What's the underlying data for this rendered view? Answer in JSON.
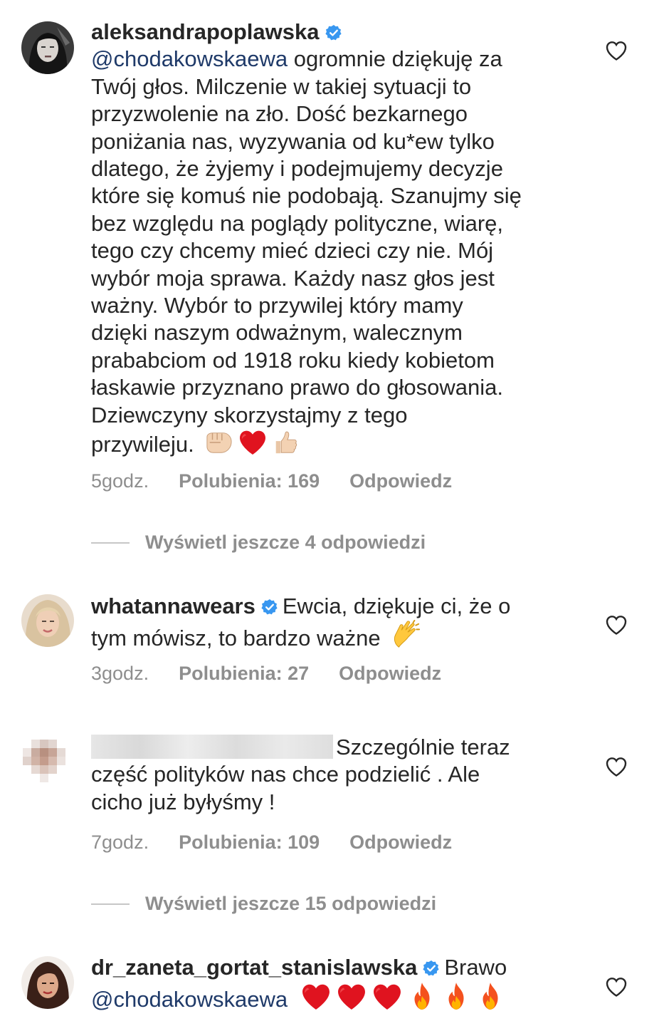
{
  "comments": [
    {
      "username": "aleksandrapoplawska",
      "verified": true,
      "mention": "@chodakowskaewa",
      "text_lines": [
        " ogromnie dziękuję za",
        "Twój głos. Milczenie w takiej sytuacji  to",
        "przyzwolenie na zło. Dość bezkarnego",
        "poniżania nas, wyzywania od ku*ew tylko",
        "dlatego, że żyjemy i podejmujemy decyzje",
        "które się komuś nie podobają. Szanujmy się",
        "bez względu na poglądy polityczne, wiarę,",
        "tego czy chcemy mieć dzieci czy nie. Mój",
        "wybór moja sprawa. Każdy nasz głos jest",
        "ważny. Wybór to przywilej który mamy",
        "dzięki naszym odważnym, walecznym",
        "prababciom od 1918 roku kiedy kobietom",
        "łaskawie przyznano prawo do głosowania.",
        "Dziewczyny skorzystajmy z tego",
        "przywileju. "
      ],
      "emojis": [
        "fist-emoji",
        "red-heart-emoji",
        "thumbs-up-emoji"
      ],
      "time": "5godz.",
      "likes": "Polubienia: 169",
      "reply": "Odpowiedz",
      "view_more": "Wyświetl jeszcze 4 odpowiedzi"
    },
    {
      "username": "whatannawears",
      "verified": true,
      "text_line1": "Ewcia, dziękuje ci, że o",
      "text_line2": "tym mówisz, to bardzo ważne ",
      "emojis": [
        "clapping-hands-emoji"
      ],
      "time": "3godz.",
      "likes": "Polubienia: 27",
      "reply": "Odpowiedz"
    },
    {
      "username_blurred": true,
      "text_line1": "Szczególnie teraz",
      "text_line2": "część polityków nas chce podzielić . Ale",
      "text_line3": "cicho już byłyśmy !",
      "time": "7godz.",
      "likes": "Polubienia: 109",
      "reply": "Odpowiedz",
      "view_more": "Wyświetl jeszcze 15 odpowiedzi"
    },
    {
      "username": "dr_zaneta_gortat_stanislawska",
      "verified": true,
      "text_after_name": "Brawo",
      "mention": "@chodakowskaewa",
      "emojis": [
        "red-heart-emoji",
        "red-heart-emoji",
        "red-heart-emoji",
        "fire-emoji",
        "fire-emoji",
        "fire-emoji"
      ]
    }
  ],
  "colors": {
    "verified_blue": "#3897f0",
    "mention": "#1f3a69",
    "meta_gray": "#8e8e8e",
    "text": "#262626"
  }
}
